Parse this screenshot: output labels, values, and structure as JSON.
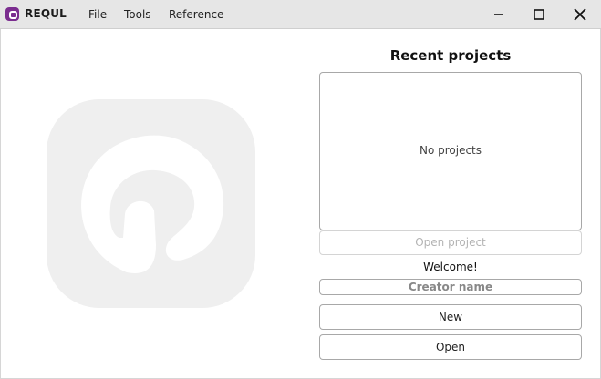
{
  "app": {
    "brand": "REQUL",
    "menu": [
      "File",
      "Tools",
      "Reference"
    ]
  },
  "window_controls": {
    "minimize_icon": "minimize-icon",
    "maximize_icon": "maximize-icon",
    "close_icon": "close-icon"
  },
  "recent": {
    "title": "Recent projects",
    "empty_text": "No projects",
    "open_project_label": "Open project"
  },
  "welcome_text": "Welcome!",
  "creator_placeholder": "Creator name",
  "actions": {
    "new_label": "New",
    "open_label": "Open"
  },
  "colors": {
    "brand": "#7b2d8f",
    "titlebar": "#e6e6e6",
    "watermark": "#efefef"
  }
}
